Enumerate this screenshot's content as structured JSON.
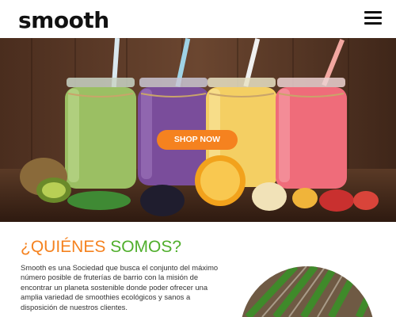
{
  "header": {
    "logo_text": "smooth",
    "menu_icon": "hamburger-menu-icon"
  },
  "hero": {
    "image_subject": "smoothie-jars-with-fruit",
    "shop_button_label": "SHOP NOW",
    "button_color": "#f5821f"
  },
  "about": {
    "title_part1": "¿QUIÉNES",
    "title_part2": "SOMOS?",
    "title_color_1": "#f5821f",
    "title_color_2": "#4fae2b",
    "body": "Smooth es una Sociedad que busca el conjunto del máximo número posible de fruterías de barrio con la misión de encontrar un planeta sostenible donde poder ofrecer una amplia variedad de smoothies ecológicos y sanos a disposición de nuestros clientes."
  },
  "colors": {
    "accent": "#f5821f",
    "green": "#4fae2b",
    "text": "#333333"
  }
}
